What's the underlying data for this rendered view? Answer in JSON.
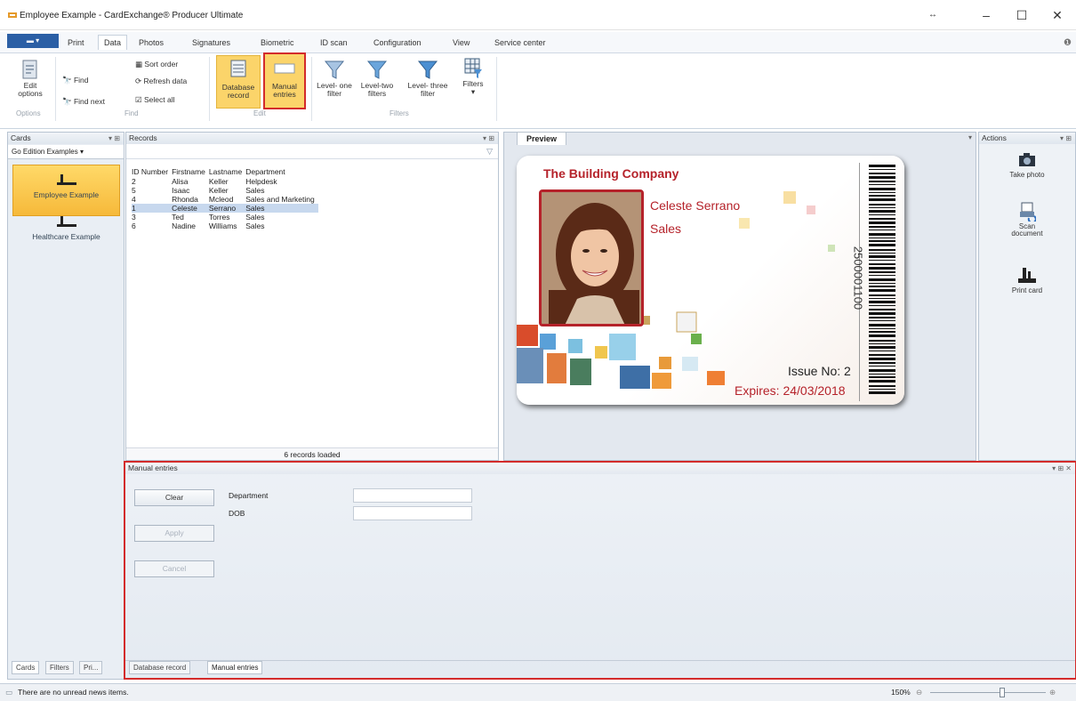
{
  "window": {
    "title": "Employee Example - CardExchange® Producer Ultimate"
  },
  "ribbon_tabs": [
    "Print",
    "Data",
    "Photos",
    "Signatures",
    "Biometric",
    "ID scan",
    "Configuration",
    "View",
    "Service center"
  ],
  "ribbon": {
    "edit_options": "Edit options",
    "find": "Find",
    "find_next": "Find next",
    "sort_order": "Sort order",
    "refresh_data": "Refresh data",
    "select_all": "Select all",
    "database_record": "Database record",
    "manual_entries": "Manual entries",
    "level_one_filter": "Level- one filter",
    "level_two_filters": "Level-two filters",
    "level_three_filter": "Level- three filter",
    "filters": "Filters",
    "groups": {
      "options": "Options",
      "find": "Find",
      "edit": "Edit",
      "filters": "Filters"
    }
  },
  "cards_panel": {
    "title": "Cards",
    "selector": "Go Edition Examples",
    "items": [
      "Employee Example",
      "Healthcare Example"
    ],
    "bottom_tabs": [
      "Cards",
      "Filters",
      "Pri..."
    ]
  },
  "records_panel": {
    "title": "Records",
    "columns": [
      "ID Number",
      "Firstname",
      "Lastname",
      "Department"
    ],
    "rows": [
      [
        "2",
        "Alisa",
        "Keller",
        "Helpdesk"
      ],
      [
        "5",
        "Isaac",
        "Keller",
        "Sales"
      ],
      [
        "4",
        "Rhonda",
        "Mcleod",
        "Sales and Marketing"
      ],
      [
        "1",
        "Celeste",
        "Serrano",
        "Sales"
      ],
      [
        "3",
        "Ted",
        "Torres",
        "Sales"
      ],
      [
        "6",
        "Nadine",
        "Williams",
        "Sales"
      ]
    ],
    "selected_row": 3,
    "status": "6 records loaded"
  },
  "preview_panel": {
    "tab": "Preview",
    "card": {
      "company": "The Building Company",
      "name": "Celeste Serrano",
      "department": "Sales",
      "vertical_number": "2500001100",
      "issue": "Issue No: 2",
      "expires": "Expires: 24/03/2018"
    }
  },
  "actions_panel": {
    "title": "Actions",
    "items": [
      "Take photo",
      "Scan document",
      "Print card"
    ]
  },
  "manual_entries": {
    "title": "Manual entries",
    "buttons": {
      "clear": "Clear",
      "apply": "Apply",
      "cancel": "Cancel"
    },
    "fields": [
      {
        "label": "Department",
        "value": ""
      },
      {
        "label": "DOB",
        "value": ""
      }
    ],
    "bottom_tabs": [
      "Database record",
      "Manual entries"
    ]
  },
  "status_bar": {
    "message": "There are no unread news items.",
    "zoom": "150%"
  },
  "colors": {
    "highlight_red": "#d32b2b",
    "selected_yellow": "#f6b93a",
    "card_red": "#b5222a"
  }
}
